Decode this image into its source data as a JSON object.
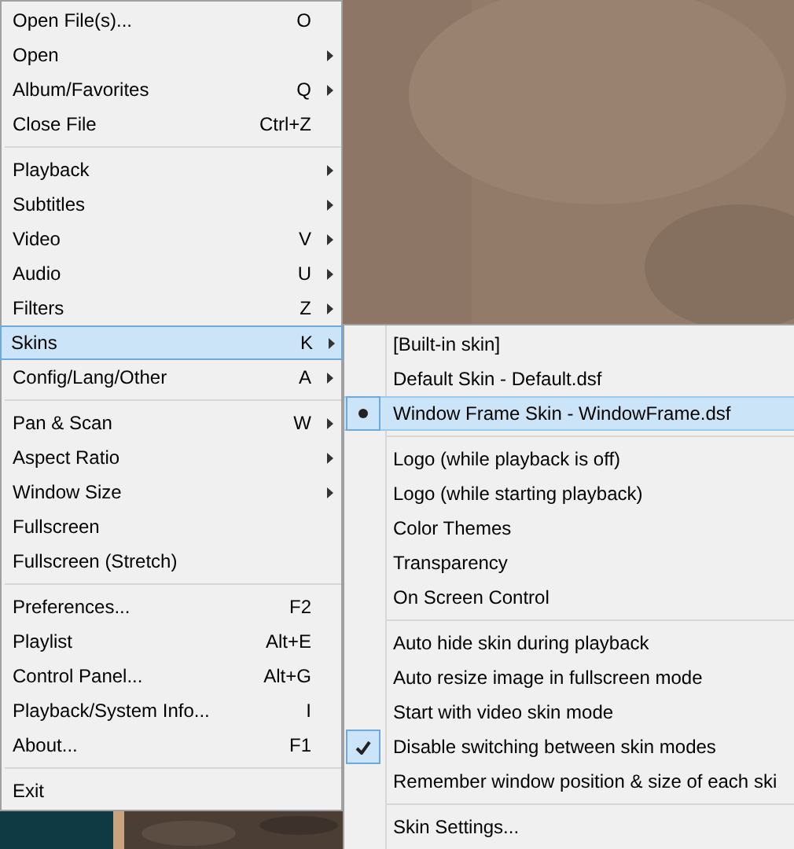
{
  "main_menu": {
    "items": [
      {
        "kind": "item",
        "label": "Open File(s)...",
        "shortcut": "O",
        "submenu": false,
        "selected": false
      },
      {
        "kind": "item",
        "label": "Open",
        "submenu": true,
        "selected": false
      },
      {
        "kind": "item",
        "label": "Album/Favorites",
        "shortcut": "Q",
        "submenu": true,
        "selected": false
      },
      {
        "kind": "item",
        "label": "Close File",
        "shortcut": "Ctrl+Z",
        "submenu": false,
        "selected": false
      },
      {
        "kind": "separator"
      },
      {
        "kind": "item",
        "label": "Playback",
        "submenu": true,
        "selected": false
      },
      {
        "kind": "item",
        "label": "Subtitles",
        "submenu": true,
        "selected": false
      },
      {
        "kind": "item",
        "label": "Video",
        "shortcut": "V",
        "submenu": true,
        "selected": false
      },
      {
        "kind": "item",
        "label": "Audio",
        "shortcut": "U",
        "submenu": true,
        "selected": false
      },
      {
        "kind": "item",
        "label": "Filters",
        "shortcut": "Z",
        "submenu": true,
        "selected": false
      },
      {
        "kind": "item",
        "label": "Skins",
        "shortcut": "K",
        "submenu": true,
        "selected": true
      },
      {
        "kind": "item",
        "label": "Config/Lang/Other",
        "shortcut": "A",
        "submenu": true,
        "selected": false
      },
      {
        "kind": "separator"
      },
      {
        "kind": "item",
        "label": "Pan & Scan",
        "shortcut": "W",
        "submenu": true,
        "selected": false
      },
      {
        "kind": "item",
        "label": "Aspect Ratio",
        "submenu": true,
        "selected": false
      },
      {
        "kind": "item",
        "label": "Window Size",
        "submenu": true,
        "selected": false
      },
      {
        "kind": "item",
        "label": "Fullscreen",
        "submenu": false,
        "selected": false
      },
      {
        "kind": "item",
        "label": "Fullscreen (Stretch)",
        "submenu": false,
        "selected": false
      },
      {
        "kind": "separator"
      },
      {
        "kind": "item",
        "label": "Preferences...",
        "shortcut": "F2",
        "submenu": false,
        "selected": false
      },
      {
        "kind": "item",
        "label": "Playlist",
        "shortcut": "Alt+E",
        "submenu": false,
        "selected": false
      },
      {
        "kind": "item",
        "label": "Control Panel...",
        "shortcut": "Alt+G",
        "submenu": false,
        "selected": false
      },
      {
        "kind": "item",
        "label": "Playback/System Info...",
        "shortcut": "I",
        "submenu": false,
        "selected": false
      },
      {
        "kind": "item",
        "label": "About...",
        "shortcut": "F1",
        "submenu": false,
        "selected": false
      },
      {
        "kind": "separator"
      },
      {
        "kind": "item",
        "label": "Exit",
        "submenu": false,
        "selected": false
      }
    ]
  },
  "skins_submenu": {
    "items": [
      {
        "kind": "radio",
        "label": "[Built-in skin]",
        "checked": false,
        "selected": false
      },
      {
        "kind": "radio",
        "label": "Default Skin - Default.dsf",
        "checked": false,
        "selected": false
      },
      {
        "kind": "radio",
        "label": "Window Frame Skin - WindowFrame.dsf",
        "checked": true,
        "selected": true
      },
      {
        "kind": "separator"
      },
      {
        "kind": "command",
        "label": "Logo (while playback is off)",
        "selected": false
      },
      {
        "kind": "command",
        "label": "Logo (while starting playback)",
        "selected": false
      },
      {
        "kind": "command",
        "label": "Color Themes",
        "selected": false
      },
      {
        "kind": "command",
        "label": "Transparency",
        "selected": false
      },
      {
        "kind": "command",
        "label": "On Screen Control",
        "selected": false
      },
      {
        "kind": "separator"
      },
      {
        "kind": "check",
        "label": "Auto hide skin during playback",
        "checked": false,
        "selected": false
      },
      {
        "kind": "check",
        "label": "Auto resize image in fullscreen mode",
        "checked": false,
        "selected": false
      },
      {
        "kind": "check",
        "label": "Start with video skin mode",
        "checked": false,
        "selected": false
      },
      {
        "kind": "check",
        "label": "Disable switching between skin modes",
        "checked": true,
        "selected": false
      },
      {
        "kind": "check",
        "label": "Remember window position & size of each ski",
        "checked": false,
        "selected": false
      },
      {
        "kind": "separator"
      },
      {
        "kind": "command",
        "label": "Skin Settings...",
        "selected": false
      }
    ]
  }
}
